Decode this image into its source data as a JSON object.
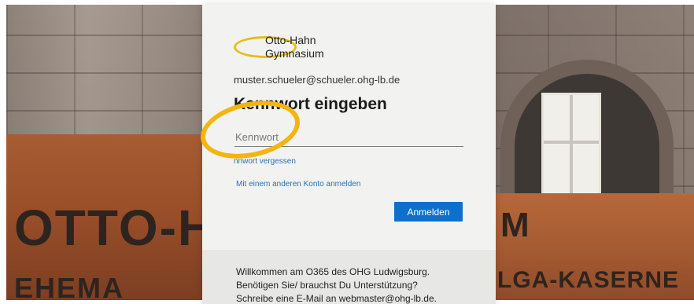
{
  "background": {
    "sign_left_top": "OTTO-H",
    "sign_left_bottom": "EHEMA",
    "sign_right_top": "M",
    "sign_right_bottom": "LGA-KASERNE"
  },
  "logo": {
    "line1": "Otto-Hahn",
    "line2": "Gymnasium"
  },
  "login": {
    "account_email": "muster.schueler@schueler.ohg-lb.de",
    "title": "Kennwort eingeben",
    "password_placeholder": "Kennwort",
    "forgot_password": "nnwort vergessen",
    "other_account": "Mit einem anderen Konto anmelden",
    "sign_in_button": "Anmelden"
  },
  "footer": {
    "line1": "Willkommen am O365 des OHG Ludwigsburg.",
    "line2": "Benötigen Sie/ brauchst Du Unterstützung?",
    "line3": "Schreibe eine E-Mail an webmaster@ohg-lb.de."
  },
  "colors": {
    "accent": "#0f6fcf",
    "annotation": "#f3b50f",
    "logo_ring": "#e3bf1b"
  }
}
